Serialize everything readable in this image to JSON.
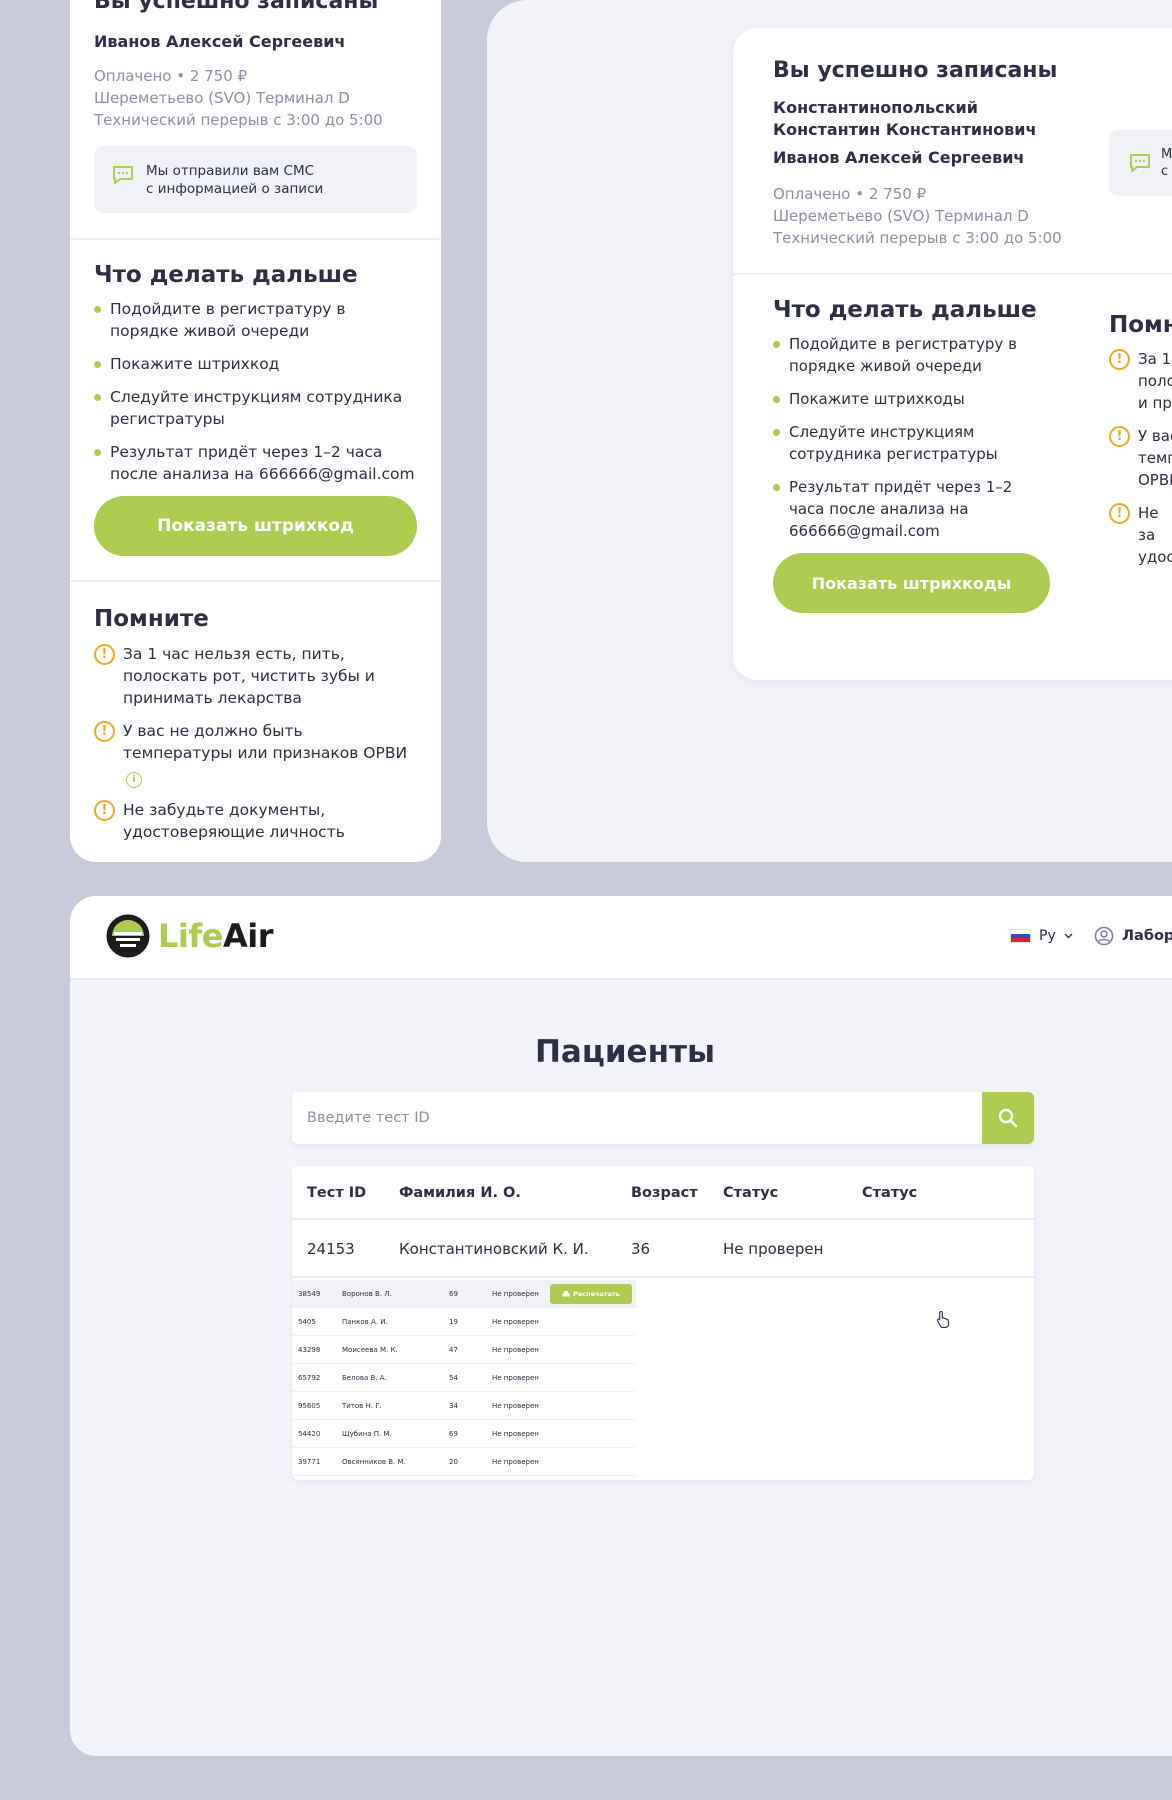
{
  "mobile": {
    "title": "Вы успешно записаны",
    "person": "Иванов Алексей Сергеевич",
    "paid_status": "Оплачено",
    "price": "2 750 ₽",
    "location": "Шереметьево (SVO) Терминал D",
    "break": "Технический перерыв с 3:00 до 5:00",
    "sms_line1": "Мы отправили вам СМС",
    "sms_line2": "с информацией о записи",
    "next_title": "Что делать дальше",
    "next_items": [
      "Подойдите в регистратуру в порядке живой очереди",
      "Покажите штрихкод",
      "Следуйте инструкциям сотрудника регистратуры",
      "Результат придёт через 1–2 часа после анализа на 666666@gmail.com"
    ],
    "show_barcode_button": "Показать штрихкод",
    "remember_title": "Помните",
    "remember_items": [
      "За 1 час нельзя есть, пить, полоскать рот, чистить зубы и принимать лекарства",
      "У вас не должно быть температуры или признаков ОРВИ",
      "Не забудьте документы, удостоверяющие личность"
    ]
  },
  "desktop": {
    "title": "Вы успешно записаны",
    "person1_line1": "Константинопольский",
    "person1_line2": "Константин Константинович",
    "person2": "Иванов Алексей Сергеевич",
    "paid_status": "Оплачено",
    "price": "2 750 ₽",
    "location": "Шереметьево (SVO) Терминал D",
    "break": "Технический перерыв с 3:00 до 5:00",
    "sms_peek": [
      "М",
      "с"
    ],
    "next_title": "Что делать дальше",
    "next_items": [
      "Подойдите в регистратуру в порядке живой очереди",
      "Покажите штрихкоды",
      "Следуйте инструкциям сотрудника регистратуры",
      "Результат придёт через 1–2 часа после анализа на 666666@gmail.com"
    ],
    "show_barcodes_button": "Показать штрихкоды",
    "remember_title_peek": "Помн",
    "remember_peek_items": [
      [
        "За 1",
        "поло",
        "и пр"
      ],
      [
        "У вас",
        "темп",
        "ОРВИ"
      ],
      [
        "Не за",
        "удос"
      ]
    ]
  },
  "app": {
    "logo_text_part1": "Life",
    "logo_text_part2": "Air",
    "brand_color": "#aecb52",
    "language": "Ру",
    "user_label": "Лабора",
    "page_title": "Пациенты",
    "search_placeholder": "Введите тест ID",
    "columns": [
      "Тест ID",
      "Фамилия И. О.",
      "Возраст",
      "Статус",
      "Статус"
    ],
    "rows": [
      [
        "24153",
        "Константиновский К. И.",
        "36",
        "Не проверен"
      ]
    ],
    "mini_print_label": "Распечатать",
    "mini_rows": [
      [
        "38549",
        "Воронов В. Л.",
        "69",
        "Не проверен"
      ],
      [
        "5405",
        "Панков А. И.",
        "19",
        "Не проверен"
      ],
      [
        "43298",
        "Моисеева М. К.",
        "47",
        "Не проверен"
      ],
      [
        "65792",
        "Белова В. А.",
        "54",
        "Не проверен"
      ],
      [
        "95605",
        "Титов Н. Г.",
        "34",
        "Не проверен"
      ],
      [
        "54420",
        "Щубина П. М.",
        "69",
        "Не проверен"
      ],
      [
        "39771",
        "Овсянников В. М.",
        "20",
        "Не проверен"
      ]
    ]
  }
}
